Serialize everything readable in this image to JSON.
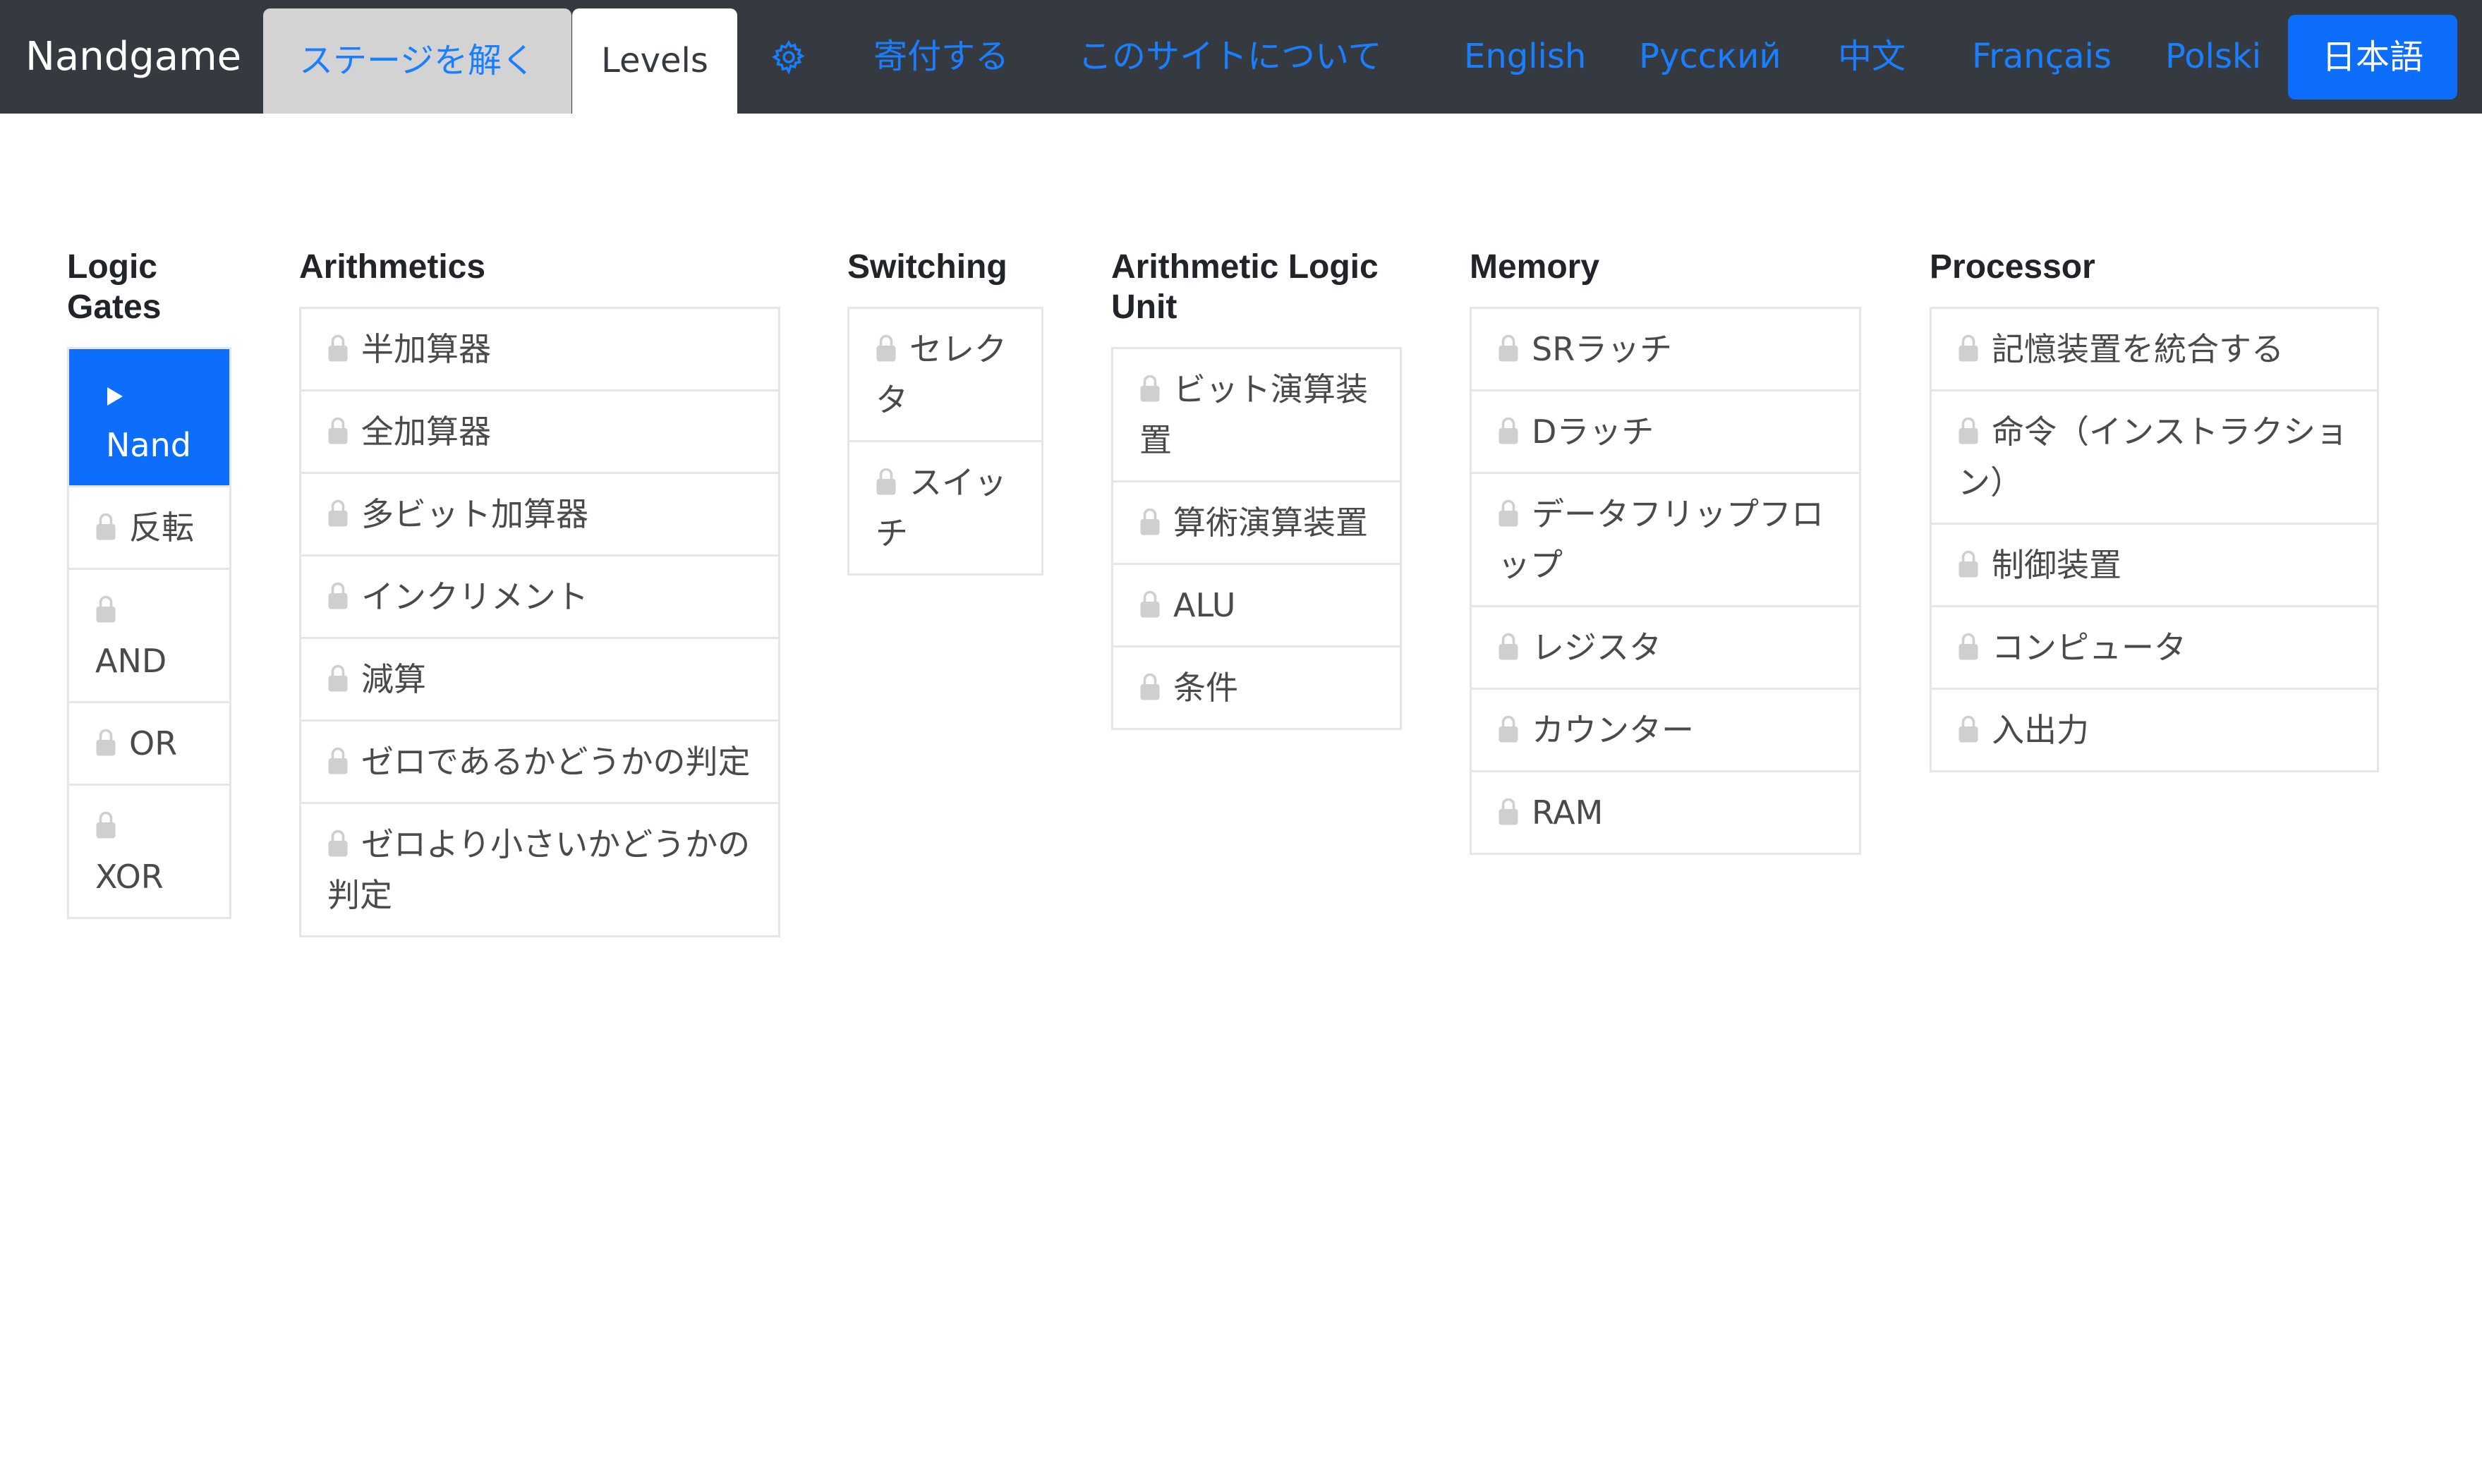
{
  "navbar": {
    "brand": "Nandgame",
    "tab_solve": "ステージを解く",
    "tab_levels": "Levels",
    "settings_icon": "gear-icon",
    "donate": "寄付する",
    "about": "このサイトについて",
    "languages": [
      "English",
      "Русский",
      "中文",
      "Français",
      "Polski"
    ],
    "active_language": "日本語"
  },
  "columns": [
    {
      "title": "Logic Gates",
      "items": [
        "Nand",
        "反転",
        "AND",
        "OR",
        "XOR"
      ]
    },
    {
      "title": "Arithmetics",
      "items": [
        "半加算器",
        "全加算器",
        "多ビット加算器",
        "インクリメント",
        "減算",
        "ゼロであるかどうかの判定",
        "ゼロより小さいかどうかの判定"
      ]
    },
    {
      "title": "Switching",
      "items": [
        "セレクタ",
        "スイッチ"
      ]
    },
    {
      "title": "Arithmetic Logic Unit",
      "items": [
        "ビット演算装置",
        "算術演算装置",
        "ALU",
        "条件"
      ]
    },
    {
      "title": "Memory",
      "items": [
        "SRラッチ",
        "Dラッチ",
        "データフリップフロップ",
        "レジスタ",
        "カウンター",
        "RAM"
      ]
    },
    {
      "title": "Processor",
      "items": [
        "記憶装置を統合する",
        "命令（インストラクション）",
        "制御装置",
        "コンピュータ",
        "入出力"
      ]
    }
  ],
  "icons": {
    "locked": "lock-icon",
    "current": "play-icon"
  },
  "colors": {
    "navbar": "#343a40",
    "accent": "#0d6efd",
    "link": "#1a7fff",
    "tab_inactive": "#d3d3d3"
  }
}
